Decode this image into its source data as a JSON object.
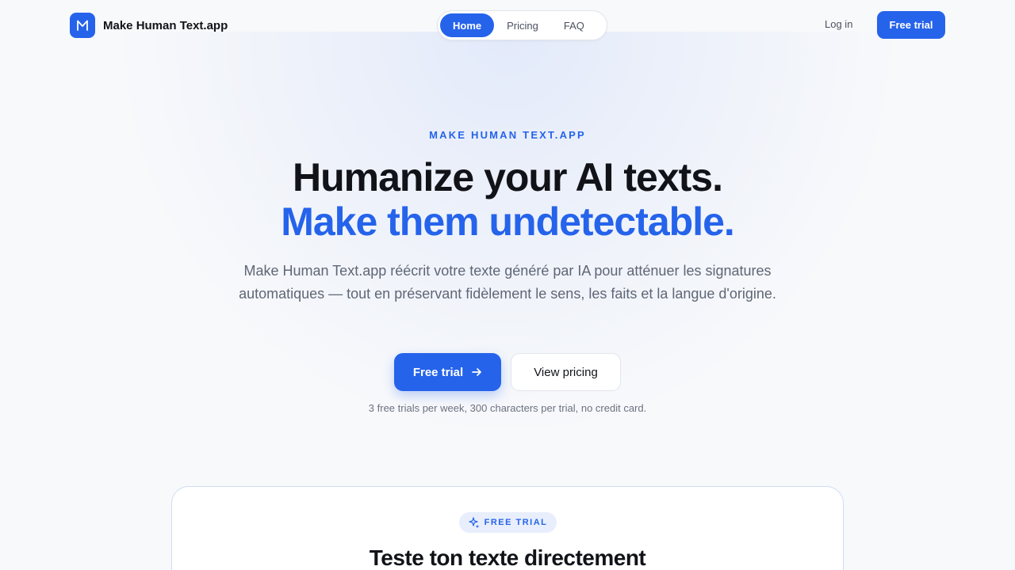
{
  "brand": {
    "name": "Make Human Text.app",
    "logo_letter": "M",
    "logo_icon": "m-logo-icon"
  },
  "nav": {
    "items": [
      {
        "label": "Home",
        "active": true
      },
      {
        "label": "Pricing",
        "active": false
      },
      {
        "label": "FAQ",
        "active": false
      }
    ]
  },
  "header_actions": {
    "login": "Log in",
    "free_trial": "Free trial"
  },
  "hero": {
    "eyebrow": "MAKE HUMAN TEXT.APP",
    "title_line1": "Humanize your AI texts.",
    "title_line2": "Make them undetectable.",
    "lead": "Make Human Text.app réécrit votre texte généré par IA pour atténuer les signatures automatiques — tout en préservant fidèlement le sens, les faits et la langue d'origine.",
    "cta_primary": "Free trial",
    "cta_secondary": "View pricing",
    "note": "3 free trials per week, 300 characters per trial, no credit card."
  },
  "card": {
    "badge": "FREE TRIAL",
    "title": "Teste ton texte directement"
  },
  "colors": {
    "accent": "#2563eb",
    "text": "#111318",
    "muted": "#5f6675",
    "background": "#f8f9fb"
  }
}
